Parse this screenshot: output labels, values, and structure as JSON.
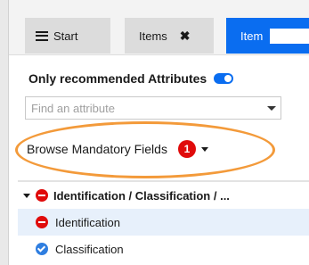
{
  "tabs": {
    "start": {
      "label": "Start"
    },
    "items": {
      "label": "Items"
    },
    "item": {
      "label": "Item"
    }
  },
  "panel": {
    "recommended_label": "Only recommended Attributes",
    "recommended_toggle": {
      "on": true
    },
    "search": {
      "placeholder": "Find an attribute",
      "value": ""
    },
    "browse": {
      "label": "Browse Mandatory Fields",
      "badge_count": "1"
    },
    "tree": {
      "group": {
        "label": "Identification / Classification / ...",
        "icon": "minus-circle-icon",
        "expanded": true
      },
      "items": [
        {
          "label": "Identification",
          "icon": "minus-circle-icon",
          "selected": true
        },
        {
          "label": "Classification",
          "icon": "check-circle-icon",
          "selected": false
        }
      ]
    }
  },
  "colors": {
    "accent_blue": "#0a6df0",
    "alert_red": "#e00b0b",
    "highlight_orange": "#f39a3a",
    "selected_row": "#e7f0fb"
  }
}
